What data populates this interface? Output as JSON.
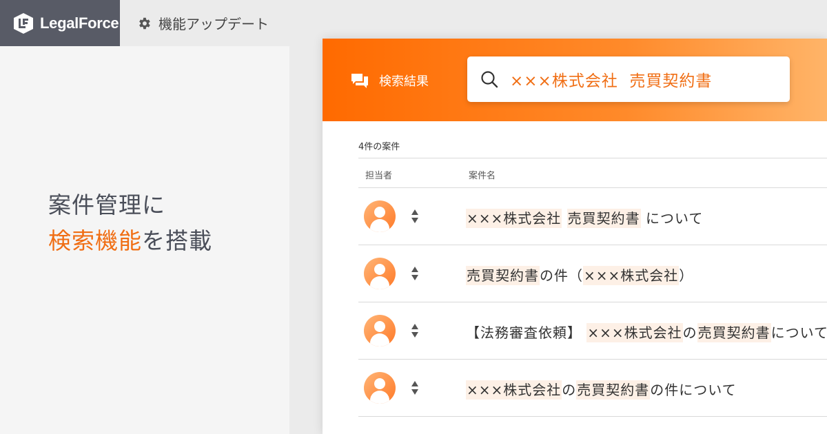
{
  "header": {
    "logo_text": "LegalForce",
    "update_link": "機能アップデート"
  },
  "headline": {
    "line1_main": "案件管理",
    "line1_suffix": "に",
    "line2_accent": "検索機能",
    "line2_suffix": "を搭載"
  },
  "search": {
    "results_label": "検索結果",
    "query": "×××株式会社  売買契約書"
  },
  "list": {
    "count_label": "4件の案件",
    "columns": {
      "assignee": "担当者",
      "matter_name": "案件名"
    },
    "rows": [
      {
        "parts": [
          "",
          "×××株式会社",
          " ",
          "売買契約書",
          " について"
        ]
      },
      {
        "parts": [
          "",
          "売買契約書",
          "の件（",
          "×××株式会社",
          "）"
        ]
      },
      {
        "parts": [
          "【法務審査依頼】 ",
          "×××株式会社",
          "の",
          "売買契約書",
          "について"
        ]
      },
      {
        "parts": [
          "",
          "×××株式会社",
          "の",
          "売買契約書",
          "の件について"
        ]
      }
    ]
  },
  "colors": {
    "accent": "#f06e14",
    "logo_bg": "#585b66",
    "highlight": "#fdf0e6"
  }
}
